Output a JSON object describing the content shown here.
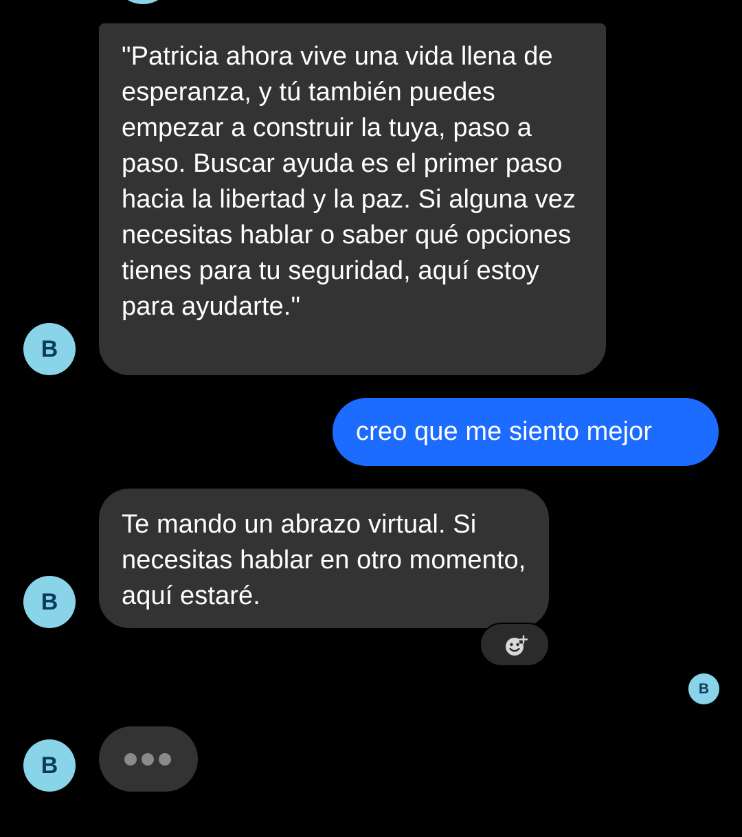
{
  "colors": {
    "background": "#000000",
    "incoming_bubble": "#333333",
    "outgoing_bubble": "#1c6cff",
    "avatar_bg": "#8ad4ea",
    "avatar_text": "#0a3a5c"
  },
  "contact": {
    "avatar_initial": "B"
  },
  "messages": [
    {
      "direction": "incoming",
      "text": "\"Patricia ahora vive una vida llena de esperanza, y tú también puedes empezar a construir la tuya, paso a paso. Buscar ayuda es el primer paso hacia la libertad y la paz. Si alguna vez necesitas hablar o saber qué opciones tienes para tu seguridad, aquí estoy para ayudarte.\""
    },
    {
      "direction": "outgoing",
      "text": "creo que me siento mejor"
    },
    {
      "direction": "incoming",
      "text": "Te mando un abrazo virtual. Si necesitas hablar en otro momento, aquí estaré."
    }
  ],
  "read_receipt": {
    "initial": "B"
  },
  "reaction_button": {
    "icon": "add-reaction-icon"
  },
  "typing_indicator": {
    "icon": "typing-dots-icon"
  }
}
